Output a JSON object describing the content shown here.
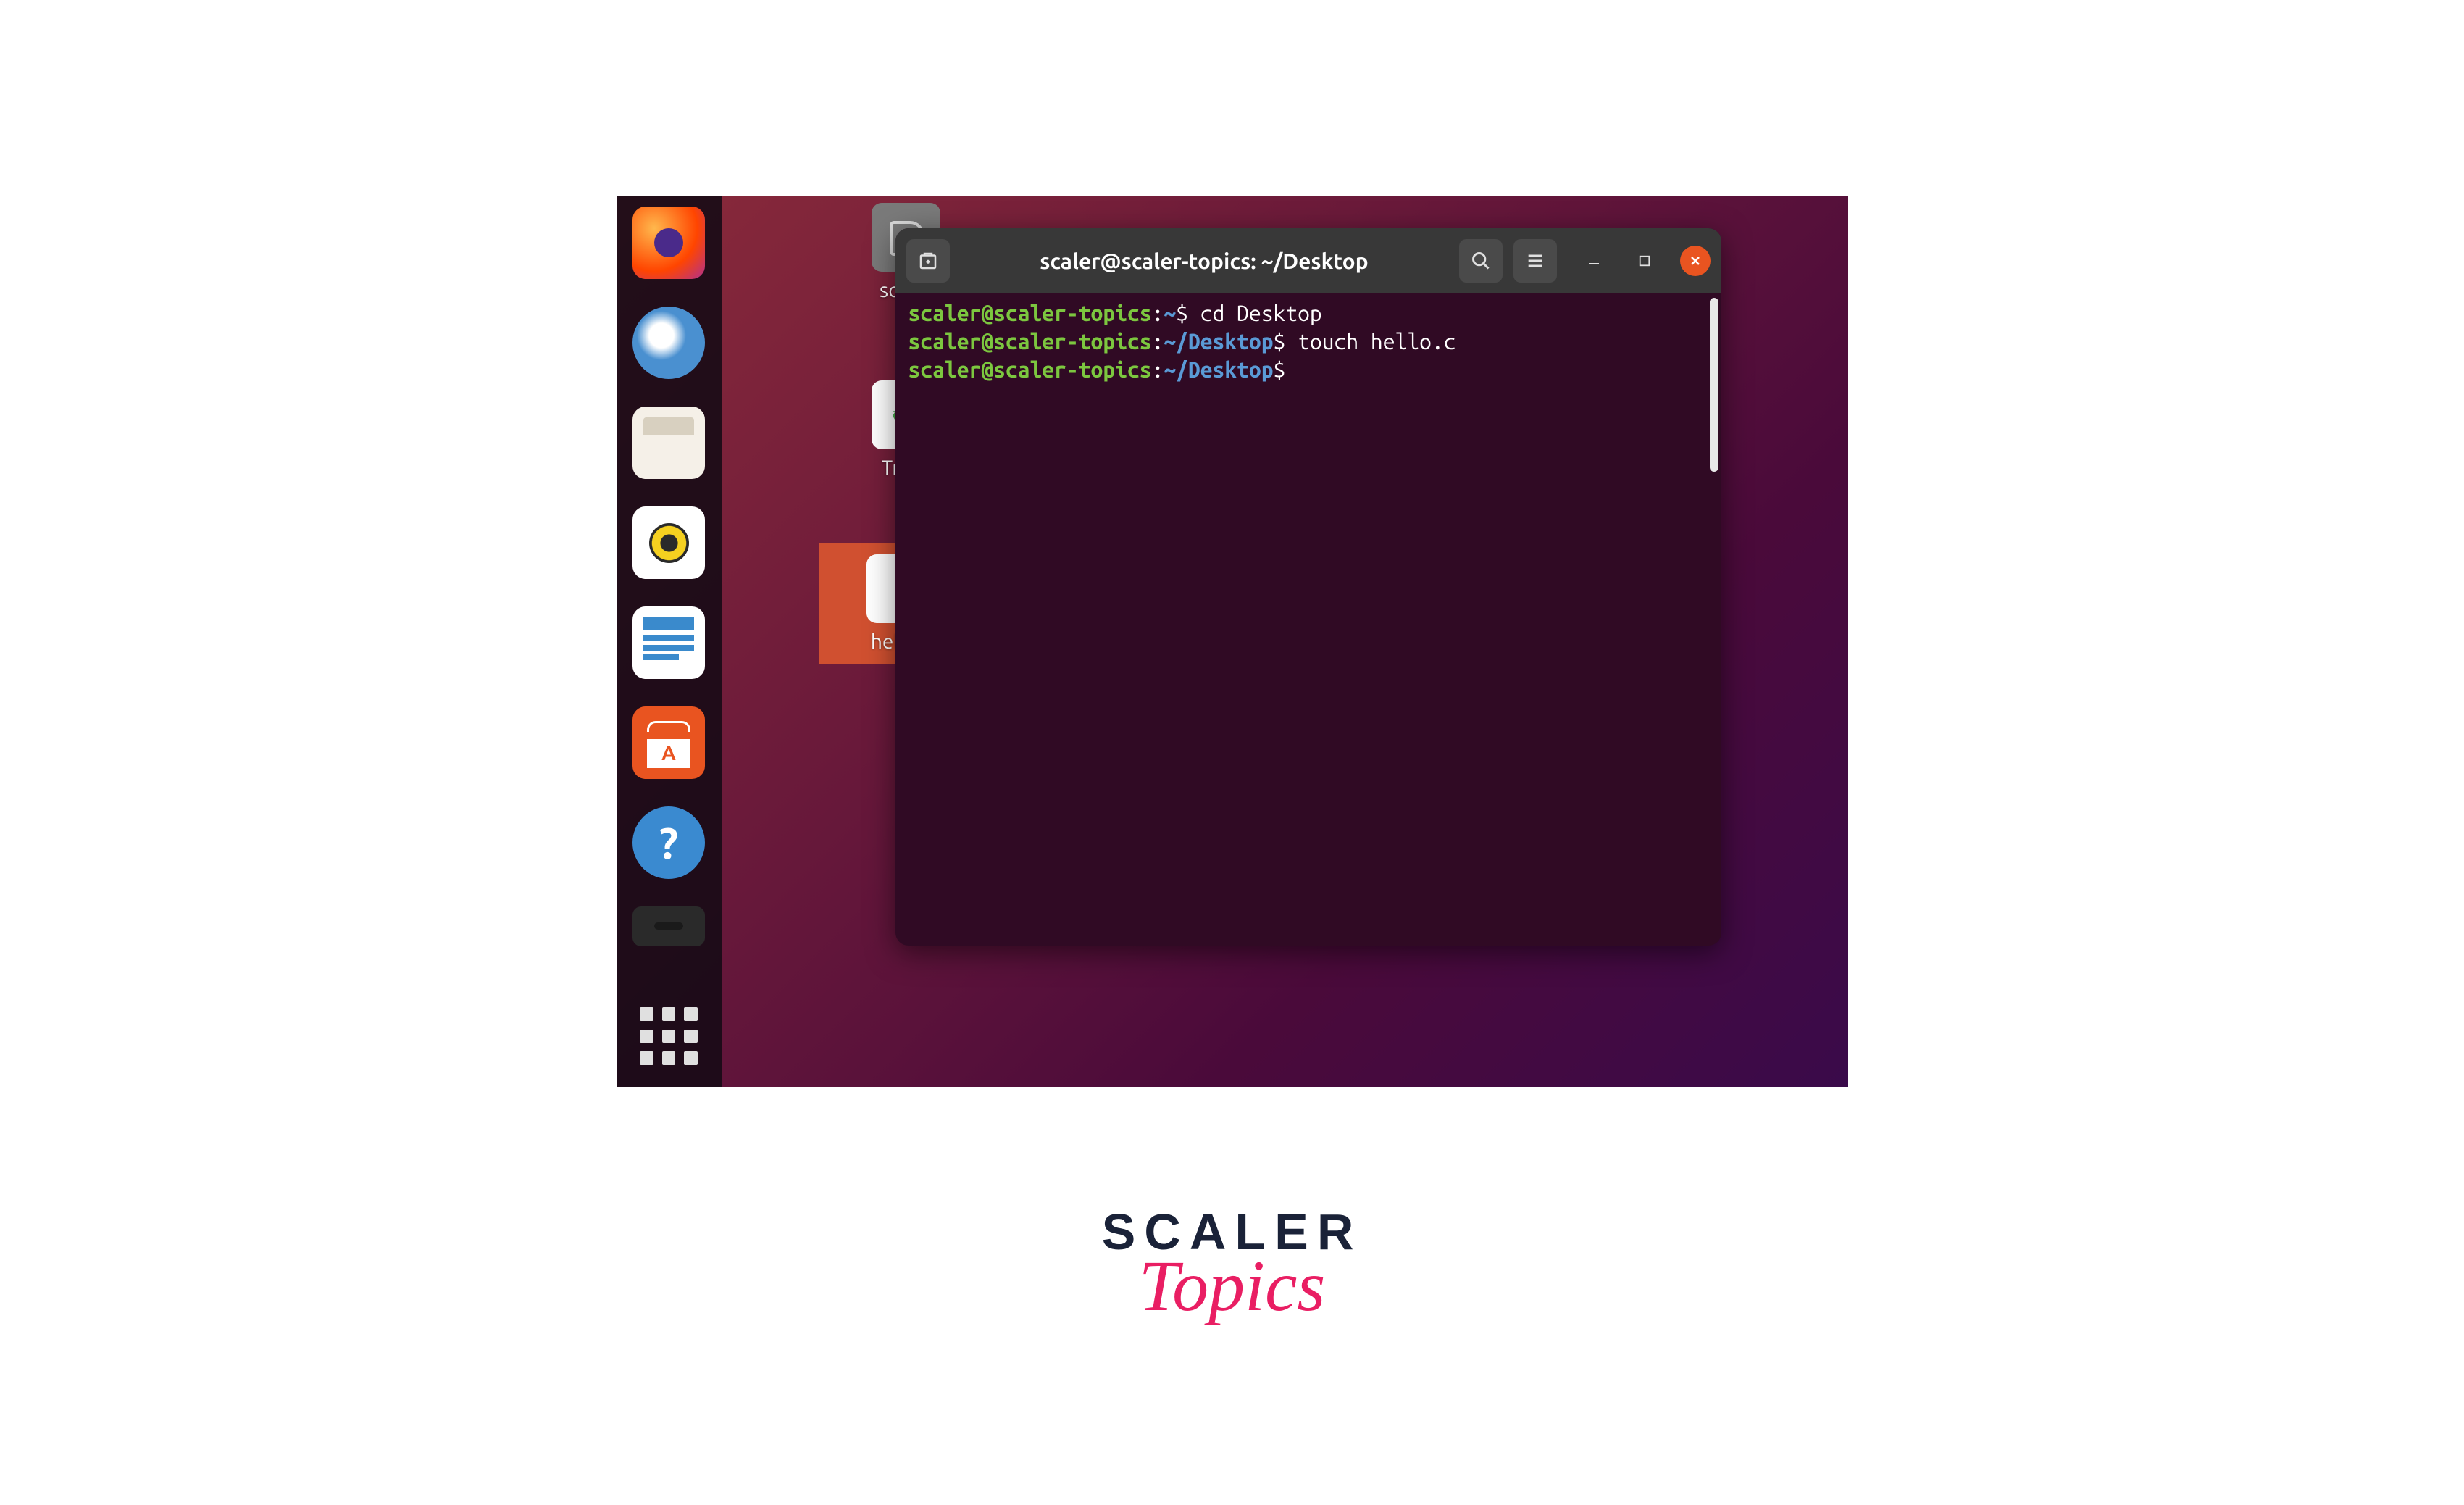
{
  "dock": {
    "items": [
      {
        "name": "firefox"
      },
      {
        "name": "thunderbird"
      },
      {
        "name": "files"
      },
      {
        "name": "rhythmbox"
      },
      {
        "name": "libreoffice-writer"
      },
      {
        "name": "ubuntu-software"
      },
      {
        "name": "help",
        "glyph": "?"
      }
    ]
  },
  "desktop": {
    "icons": [
      {
        "label": "scaler",
        "type": "home"
      },
      {
        "label": "Trash",
        "type": "trash"
      },
      {
        "label": "hello.c",
        "type": "file",
        "selected": true
      }
    ]
  },
  "terminal": {
    "title": "scaler@scaler-topics: ~/Desktop",
    "lines": [
      {
        "user": "scaler@scaler-topics",
        "path": "~",
        "cmd": "cd Desktop"
      },
      {
        "user": "scaler@scaler-topics",
        "path": "~/Desktop",
        "cmd": "touch hello.c"
      },
      {
        "user": "scaler@scaler-topics",
        "path": "~/Desktop",
        "cmd": ""
      }
    ]
  },
  "branding": {
    "line1": "SCALER",
    "line2": "Topics"
  }
}
